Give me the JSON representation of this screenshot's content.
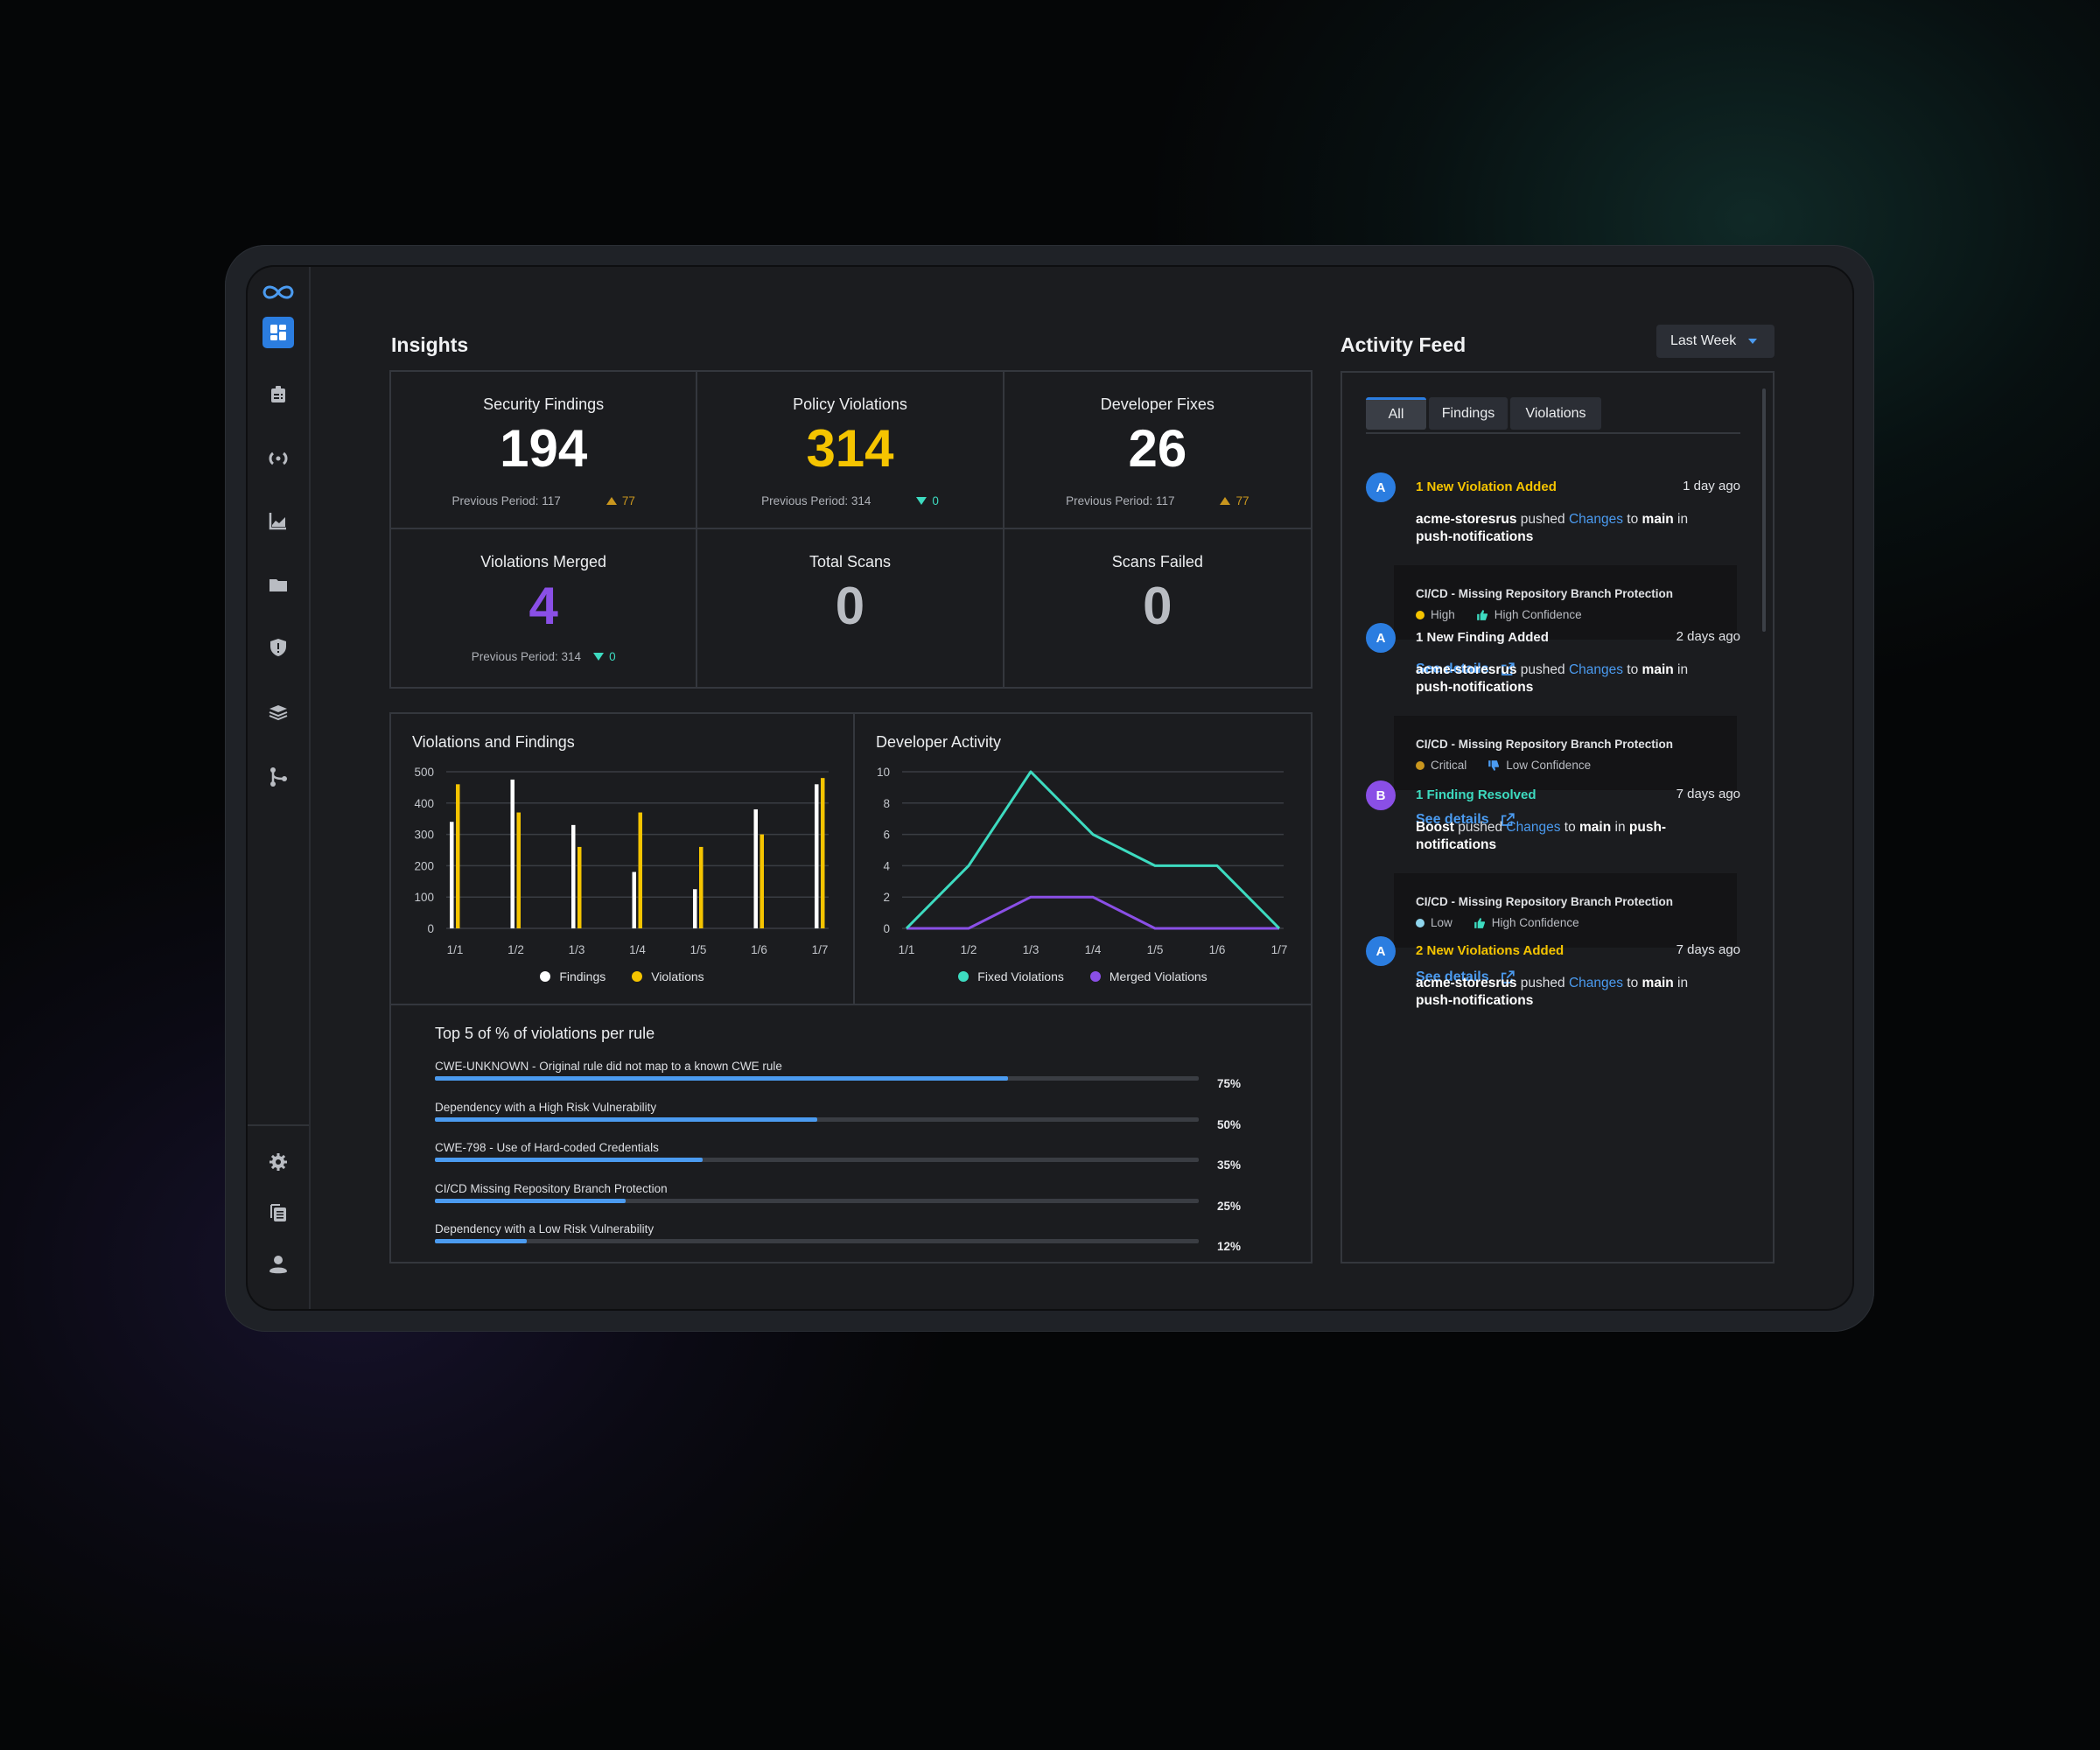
{
  "colors": {
    "accent": "#2b7de0",
    "link": "#4b9bf0",
    "yellow": "#f5c400",
    "teal": "#3ddbc0",
    "purple": "#8a4fe6",
    "up_delta": "#c9961e",
    "critical": "#c9961e",
    "low": "#8fd6ee"
  },
  "sidebar": {
    "logo": "infinity-logo",
    "items": [
      {
        "icon": "dashboard-icon",
        "active": true
      },
      {
        "icon": "clipboard-icon",
        "active": false
      },
      {
        "icon": "broadcast-icon",
        "active": false
      },
      {
        "icon": "area-chart-icon",
        "active": false
      },
      {
        "icon": "folder-icon",
        "active": false
      },
      {
        "icon": "shield-alert-icon",
        "active": false
      },
      {
        "icon": "layers-icon",
        "active": false
      },
      {
        "icon": "branch-icon",
        "active": false
      }
    ],
    "bottom_items": [
      {
        "icon": "gear-icon"
      },
      {
        "icon": "documents-icon"
      },
      {
        "icon": "user-icon"
      }
    ]
  },
  "insights": {
    "title": "Insights",
    "stats": [
      {
        "label": "Security Findings",
        "value": "194",
        "value_color": "#ffffff",
        "prev": "Previous Period: 117",
        "delta": "77",
        "delta_dir": "up"
      },
      {
        "label": "Policy Violations",
        "value": "314",
        "value_color": "#f5c400",
        "prev": "Previous Period: 314",
        "delta": "0",
        "delta_dir": "down"
      },
      {
        "label": "Developer Fixes",
        "value": "26",
        "value_color": "#ffffff",
        "prev": "Previous Period: 117",
        "delta": "77",
        "delta_dir": "up"
      },
      {
        "label": "Violations Merged",
        "value": "4",
        "value_color": "#8a4fe6",
        "prev": "Previous Period: 314",
        "delta": "0",
        "delta_dir": "down"
      },
      {
        "label": "Total Scans",
        "value": "0",
        "value_color": "#b9bcc2"
      },
      {
        "label": "Scans Failed",
        "value": "0",
        "value_color": "#b9bcc2"
      }
    ]
  },
  "chart_data": [
    {
      "type": "bar",
      "title": "Violations and Findings",
      "categories": [
        "1/1",
        "1/2",
        "1/3",
        "1/4",
        "1/5",
        "1/6",
        "1/7"
      ],
      "series": [
        {
          "name": "Findings",
          "color": "#ffffff",
          "values": [
            340,
            475,
            330,
            180,
            125,
            380,
            460
          ]
        },
        {
          "name": "Violations",
          "color": "#f5c400",
          "values": [
            460,
            370,
            260,
            370,
            260,
            300,
            480
          ]
        }
      ],
      "yticks": [
        0,
        100,
        200,
        300,
        400,
        500
      ],
      "ylim": [
        0,
        500
      ],
      "xlabel": "",
      "ylabel": "",
      "grid": true,
      "legend": "bottom"
    },
    {
      "type": "line",
      "title": "Developer Activity",
      "categories": [
        "1/1",
        "1/2",
        "1/3",
        "1/4",
        "1/5",
        "1/6",
        "1/7"
      ],
      "series": [
        {
          "name": "Fixed Violations",
          "color": "#3ddbc0",
          "values": [
            0,
            4,
            10,
            6,
            4,
            4,
            0
          ]
        },
        {
          "name": "Merged Violations",
          "color": "#8a4fe6",
          "values": [
            0,
            0,
            2,
            2,
            0,
            0,
            0
          ]
        }
      ],
      "yticks": [
        0,
        2,
        4,
        6,
        8,
        10
      ],
      "ylim": [
        0,
        10
      ],
      "xlabel": "",
      "ylabel": "",
      "grid": true,
      "legend": "bottom"
    }
  ],
  "top_rules": {
    "title": "Top 5 of % of violations per rule",
    "rules": [
      {
        "label": "CWE-UNKNOWN - Original rule did not map to a known CWE rule",
        "percent": 75,
        "percent_label": "75%"
      },
      {
        "label": "Dependency with a High Risk Vulnerability",
        "percent": 50,
        "percent_label": "50%"
      },
      {
        "label": "CWE-798 - Use of Hard-coded Credentials",
        "percent": 35,
        "percent_label": "35%"
      },
      {
        "label": "CI/CD Missing Repository Branch Protection",
        "percent": 25,
        "percent_label": "25%"
      },
      {
        "label": "Dependency with a Low Risk Vulnerability",
        "percent": 12,
        "percent_label": "12%"
      }
    ]
  },
  "activity": {
    "title": "Activity Feed",
    "period": "Last Week",
    "tabs": [
      {
        "label": "All",
        "active": true
      },
      {
        "label": "Findings",
        "active": false
      },
      {
        "label": "Violations",
        "active": false
      }
    ],
    "items": [
      {
        "avatar": "A",
        "avatar_color": "blue",
        "headline": "1 New Violation Added",
        "headline_color": "#f5c400",
        "time": "1 day ago",
        "actor": "acme-storesrus",
        "verb": "pushed",
        "link": "Changes",
        "to": "to",
        "branch": "main",
        "in": "in",
        "repo": "push-notifications",
        "rule": "CI/CD - Missing Repository Branch Protection",
        "severity": "High",
        "severity_color": "#f5c400",
        "confidence": "High Confidence",
        "confidence_icon": "thumbs-up-icon",
        "confidence_color": "#3ddbc0",
        "see_details": "See details"
      },
      {
        "avatar": "A",
        "avatar_color": "blue",
        "headline": "1 New Finding Added",
        "headline_color": "#f1f2f4",
        "time": "2 days ago",
        "actor": "acme-storesrus",
        "verb": "pushed",
        "link": "Changes",
        "to": "to",
        "branch": "main",
        "in": "in",
        "repo": "push-notifications",
        "rule": "CI/CD - Missing Repository Branch Protection",
        "severity": "Critical",
        "severity_color": "#c9961e",
        "confidence": "Low Confidence",
        "confidence_icon": "thumbs-down-icon",
        "confidence_color": "#4b9bf0",
        "see_details": "See details"
      },
      {
        "avatar": "B",
        "avatar_color": "purple",
        "headline": "1 Finding Resolved",
        "headline_color": "#3ddbc0",
        "time": "7 days ago",
        "actor": "Boost",
        "verb": "pushed",
        "link": "Changes",
        "to": "to",
        "branch": "main",
        "in": "in",
        "repo": "push-notifications",
        "rule": "CI/CD - Missing Repository Branch Protection",
        "severity": "Low",
        "severity_color": "#8fd6ee",
        "confidence": "High Confidence",
        "confidence_icon": "thumbs-up-icon",
        "confidence_color": "#3ddbc0",
        "see_details": "See details"
      },
      {
        "avatar": "A",
        "avatar_color": "blue",
        "headline": "2 New Violations Added",
        "headline_color": "#f5c400",
        "time": "7 days ago",
        "actor": "acme-storesrus",
        "verb": "pushed",
        "link": "Changes",
        "to": "to",
        "branch": "main",
        "in": "in",
        "repo": "push-notifications"
      }
    ]
  }
}
